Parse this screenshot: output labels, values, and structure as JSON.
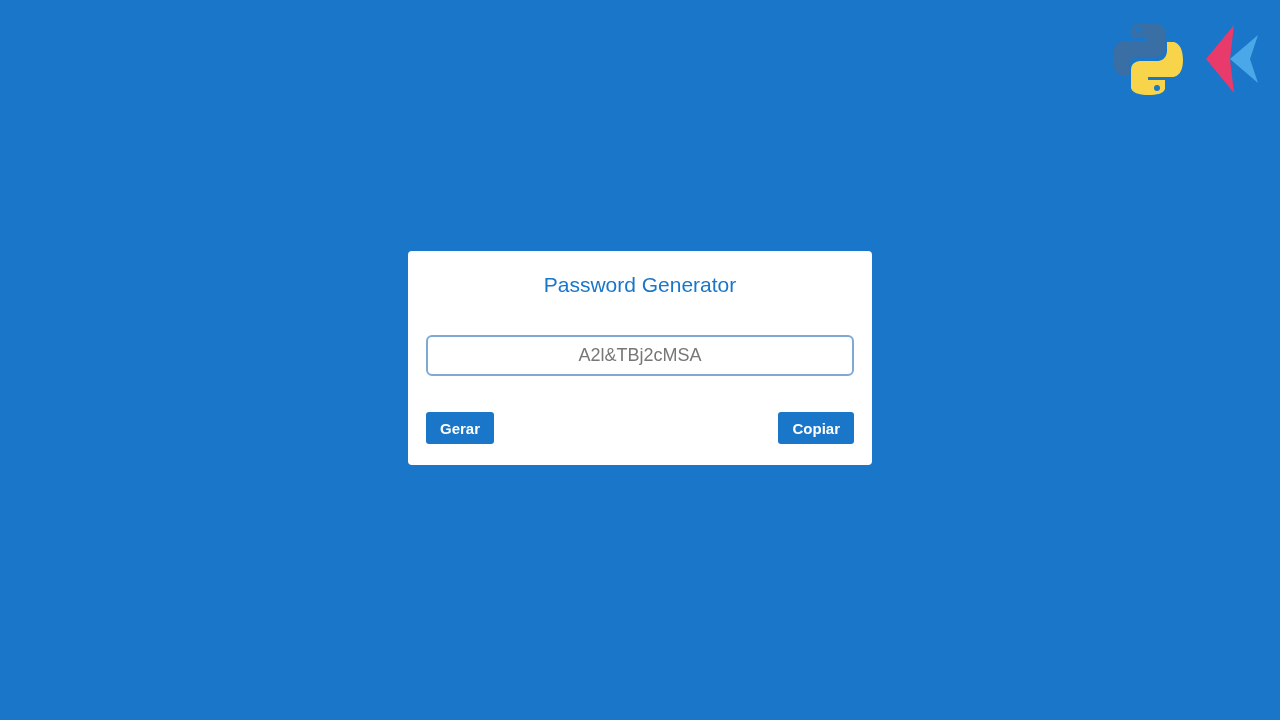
{
  "card": {
    "title": "Password Generator",
    "password_field": {
      "value": "A2l&TBj2cMSA"
    },
    "buttons": [
      {
        "label": "Gerar"
      },
      {
        "label": "Copiar"
      }
    ]
  }
}
